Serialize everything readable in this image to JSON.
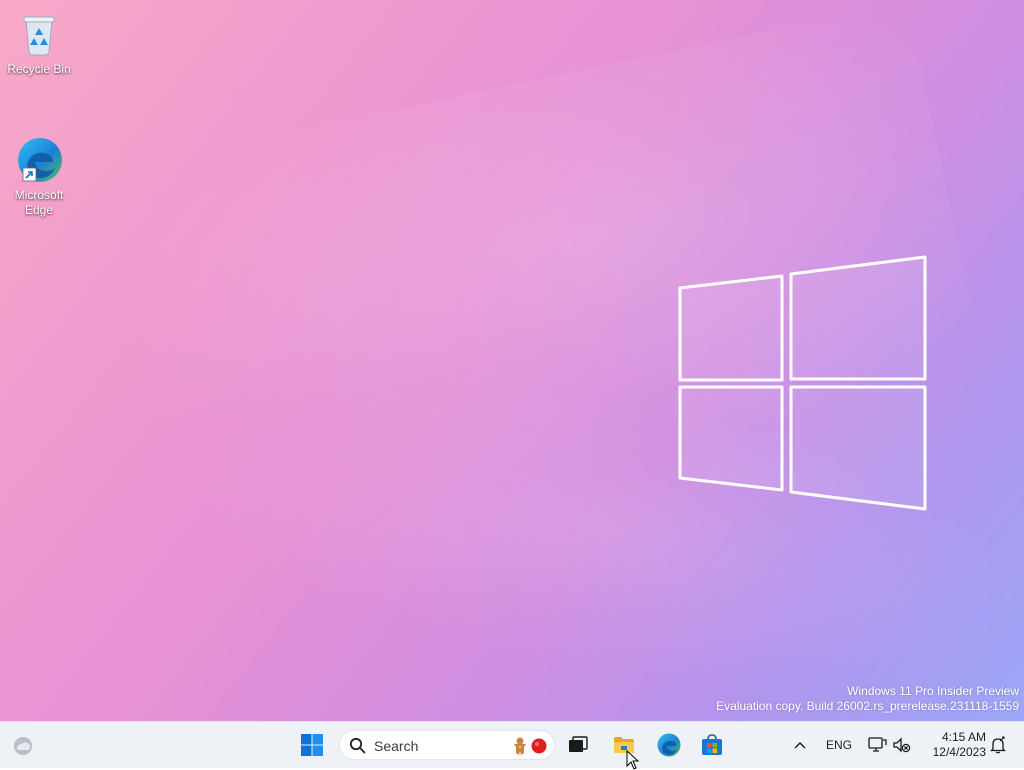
{
  "desktop": {
    "icons": [
      {
        "label": "Recycle Bin",
        "icon": "recycle-bin-icon"
      },
      {
        "label": "Microsoft\nEdge",
        "icon": "edge-icon"
      }
    ],
    "watermark": {
      "line1": "Windows 11 Pro Insider Preview",
      "line2": "Evaluation copy. Build 26002.rs_prerelease.231118-1559"
    }
  },
  "taskbar": {
    "widgets_icon": "widgets-weather-icon",
    "start_icon": "windows-start-icon",
    "search_placeholder": "Search",
    "search_highlight_icons": [
      "gingerbread-icon",
      "red-dot-icon"
    ],
    "pinned_apps": [
      {
        "name": "Task View",
        "icon": "task-view-icon"
      },
      {
        "name": "File Explorer",
        "icon": "file-explorer-icon"
      },
      {
        "name": "Microsoft Edge",
        "icon": "edge-icon"
      },
      {
        "name": "Microsoft Store",
        "icon": "store-icon"
      }
    ],
    "tray": {
      "overflow_icon": "chevron-up-icon",
      "language": "ENG",
      "network_icon": "network-icon",
      "volume_icon": "volume-muted-icon",
      "time": "4:15 AM",
      "date": "12/4/2023",
      "notification_icon": "notification-icon"
    }
  },
  "colors": {
    "accent": "#0078d4",
    "taskbar_bg": "#eef1f5",
    "wallpaper_pink": "#f8a9c6",
    "wallpaper_purple": "#b196ef"
  }
}
